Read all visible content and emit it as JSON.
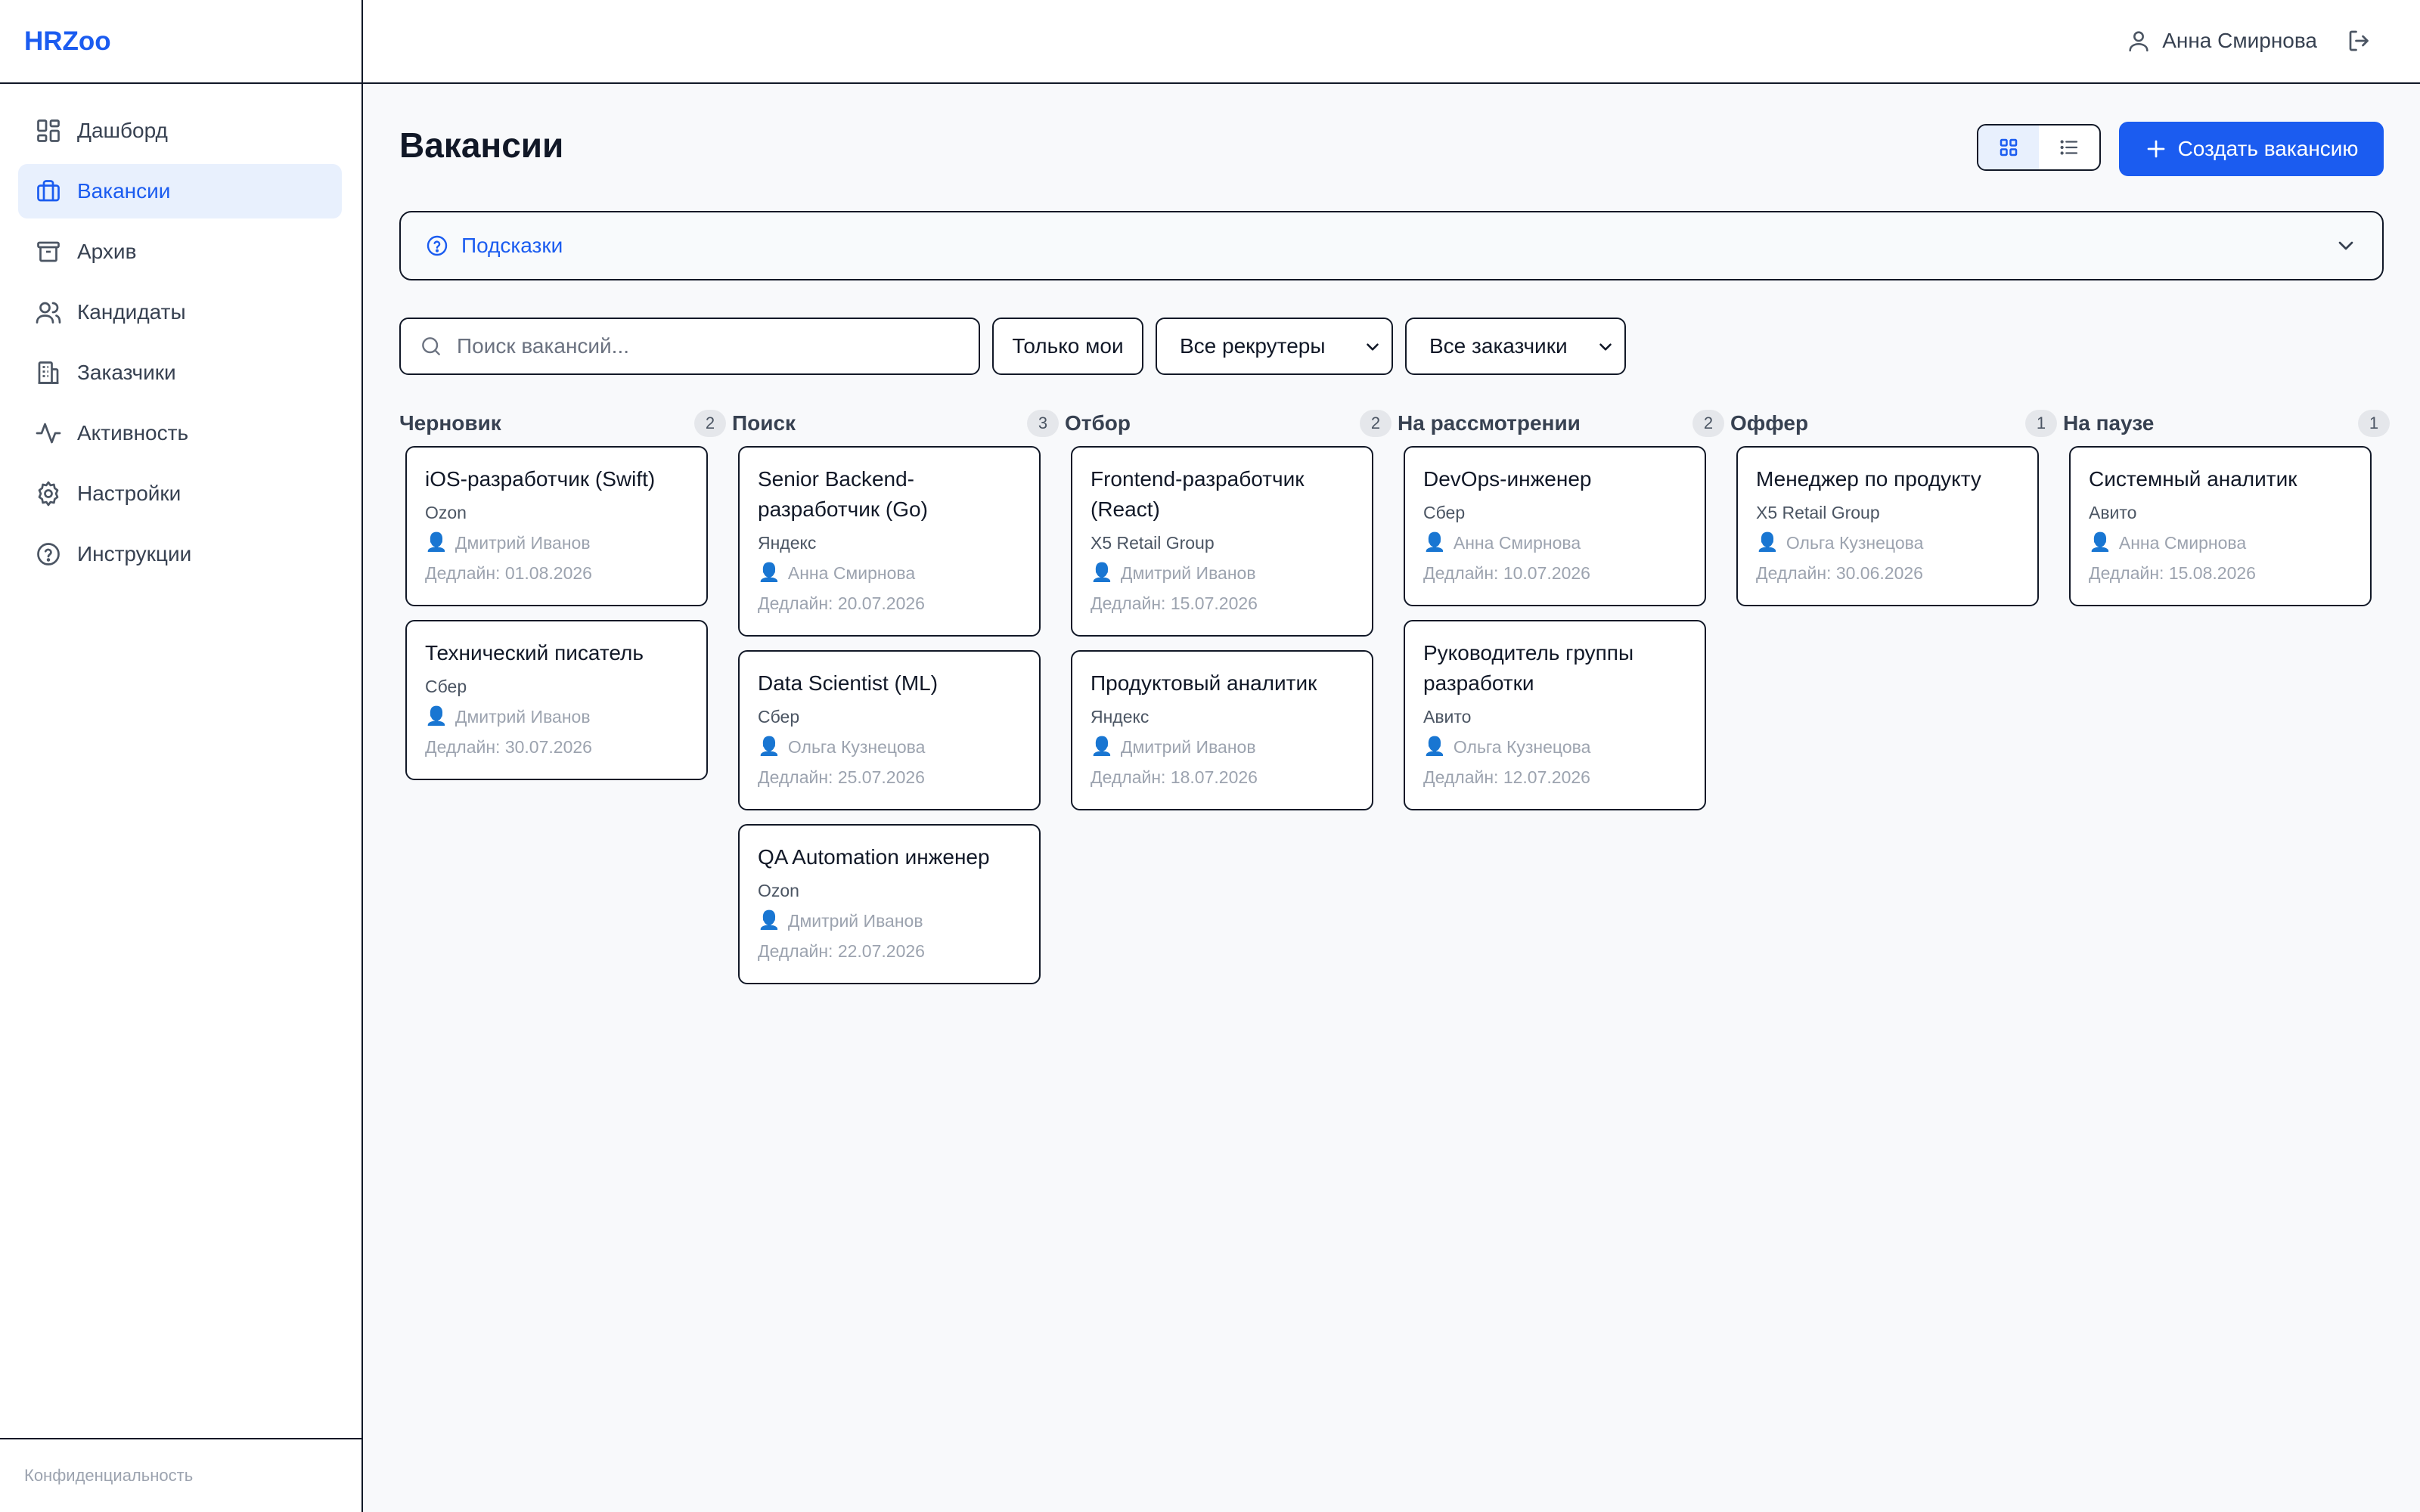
{
  "app": {
    "brand": "HRZoo"
  },
  "sidebar": {
    "items": [
      {
        "label": "Дашборд",
        "icon": "dashboard-icon",
        "active": false
      },
      {
        "label": "Вакансии",
        "icon": "briefcase-icon",
        "active": true
      },
      {
        "label": "Архив",
        "icon": "archive-icon",
        "active": false
      },
      {
        "label": "Кандидаты",
        "icon": "users-icon",
        "active": false
      },
      {
        "label": "Заказчики",
        "icon": "building-icon",
        "active": false
      },
      {
        "label": "Активность",
        "icon": "activity-icon",
        "active": false
      },
      {
        "label": "Настройки",
        "icon": "gear-icon",
        "active": false
      },
      {
        "label": "Инструкции",
        "icon": "help-circle-icon",
        "active": false
      }
    ],
    "footer_link": "Конфиденциальность"
  },
  "header": {
    "user_name": "Анна Смирнова"
  },
  "main": {
    "title": "Вакансии",
    "create_button": "Создать вакансию",
    "hints_label": "Подсказки",
    "search": {
      "placeholder": "Поиск вакансий...",
      "value": ""
    },
    "only_mine_label": "Только мои",
    "recruiter_select": "Все рекрутеры",
    "customer_select": "Все заказчики"
  },
  "colors": {
    "accent": "#1b5cf0",
    "active_bg": "#e8f0fd"
  },
  "board": {
    "columns": [
      {
        "title": "Черновик",
        "count": "2",
        "cards": [
          {
            "title": "iOS-разработчик (Swift)",
            "client": "Ozon",
            "recruiter": "Дмитрий Иванов",
            "deadline": "Дедлайн: 01.08.2026"
          },
          {
            "title": "Технический писатель",
            "client": "Сбер",
            "recruiter": "Дмитрий Иванов",
            "deadline": "Дедлайн: 30.07.2026"
          }
        ]
      },
      {
        "title": "Поиск",
        "count": "3",
        "cards": [
          {
            "title": "Senior Backend-разработчик (Go)",
            "client": "Яндекс",
            "recruiter": "Анна Смирнова",
            "deadline": "Дедлайн: 20.07.2026"
          },
          {
            "title": "Data Scientist (ML)",
            "client": "Сбер",
            "recruiter": "Ольга Кузнецова",
            "deadline": "Дедлайн: 25.07.2026"
          },
          {
            "title": "QA Automation инженер",
            "client": "Ozon",
            "recruiter": "Дмитрий Иванов",
            "deadline": "Дедлайн: 22.07.2026"
          }
        ]
      },
      {
        "title": "Отбор",
        "count": "2",
        "cards": [
          {
            "title": "Frontend-разработчик (React)",
            "client": "X5 Retail Group",
            "recruiter": "Дмитрий Иванов",
            "deadline": "Дедлайн: 15.07.2026"
          },
          {
            "title": "Продуктовый аналитик",
            "client": "Яндекс",
            "recruiter": "Дмитрий Иванов",
            "deadline": "Дедлайн: 18.07.2026"
          }
        ]
      },
      {
        "title": "На рассмотрении",
        "count": "2",
        "cards": [
          {
            "title": "DevOps-инженер",
            "client": "Сбер",
            "recruiter": "Анна Смирнова",
            "deadline": "Дедлайн: 10.07.2026"
          },
          {
            "title": "Руководитель группы разработки",
            "client": "Авито",
            "recruiter": "Ольга Кузнецова",
            "deadline": "Дедлайн: 12.07.2026"
          }
        ]
      },
      {
        "title": "Оффер",
        "count": "1",
        "cards": [
          {
            "title": "Менеджер по продукту",
            "client": "X5 Retail Group",
            "recruiter": "Ольга Кузнецова",
            "deadline": "Дедлайн: 30.06.2026"
          }
        ]
      },
      {
        "title": "На паузе",
        "count": "1",
        "cards": [
          {
            "title": "Системный аналитик",
            "client": "Авито",
            "recruiter": "Анна Смирнова",
            "deadline": "Дедлайн: 15.08.2026"
          }
        ]
      }
    ]
  }
}
